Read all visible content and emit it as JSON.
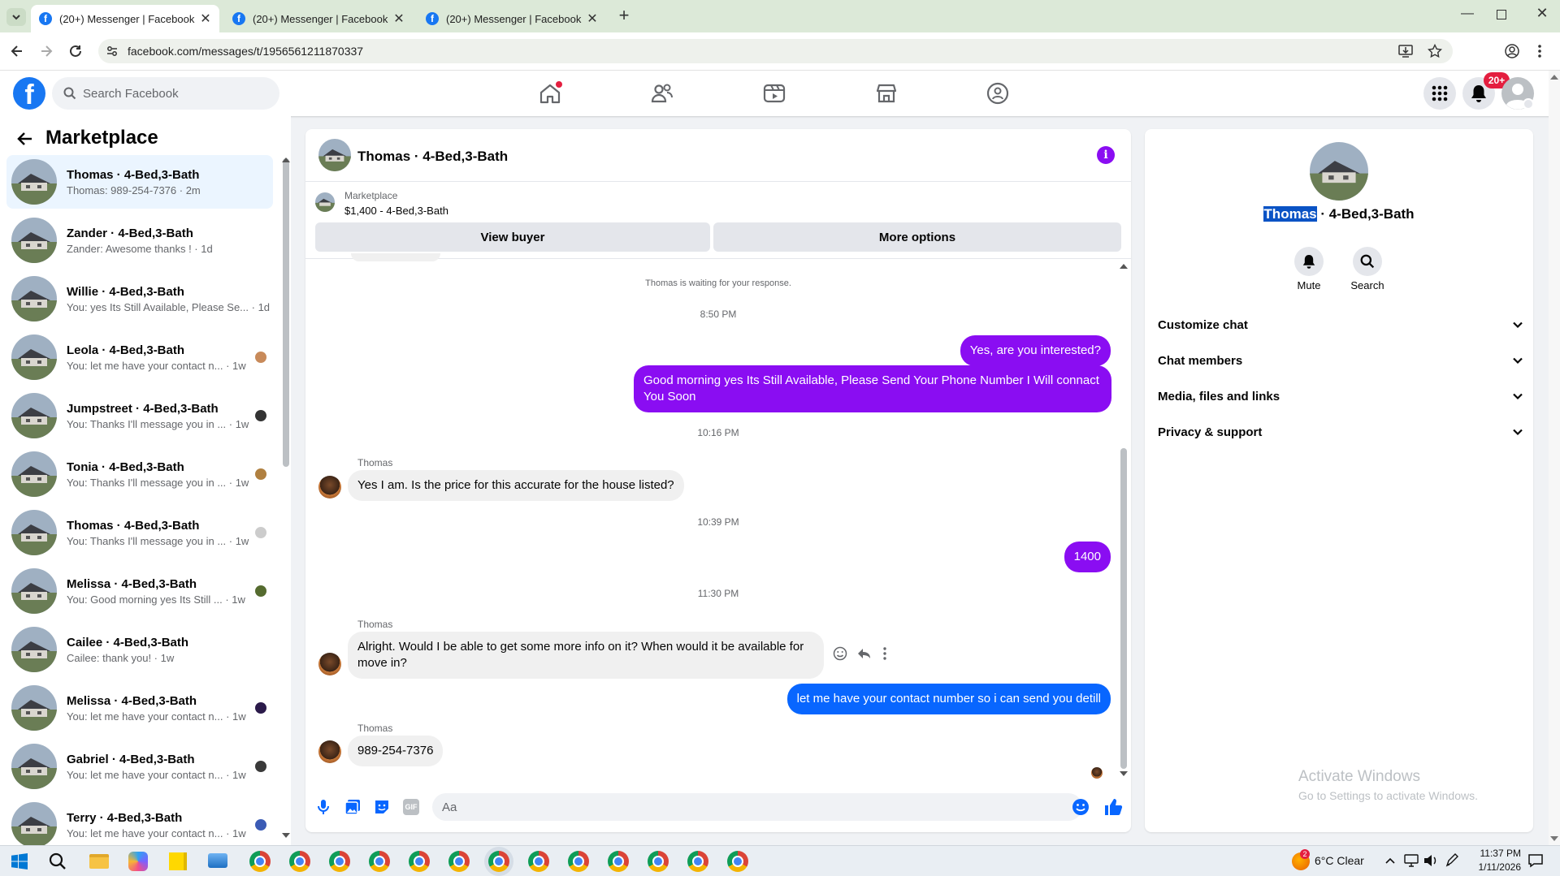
{
  "browser": {
    "tabs": [
      {
        "title": "(20+) Messenger | Facebook"
      },
      {
        "title": "(20+) Messenger | Facebook"
      },
      {
        "title": "(20+) Messenger | Facebook"
      }
    ],
    "url": "facebook.com/messages/t/1956561211870337"
  },
  "facebook": {
    "search_placeholder": "Search Facebook",
    "notification_badge": "20+"
  },
  "sidebar": {
    "title": "Marketplace",
    "conversations": [
      {
        "name": "Thomas · 4-Bed,3-Bath",
        "preview": "Thomas: 989-254-7376 · 2m",
        "selected": true
      },
      {
        "name": "Zander · 4-Bed,3-Bath",
        "preview": "Zander: Awesome thanks ! · 1d"
      },
      {
        "name": "Willie · 4-Bed,3-Bath",
        "preview": "You: yes Its Still Available, Please Se... · 1d"
      },
      {
        "name": "Leola · 4-Bed,3-Bath",
        "preview": "You: let me have your contact n... · 1w"
      },
      {
        "name": "Jumpstreet · 4-Bed,3-Bath",
        "preview": "You: Thanks I'll message you in ... · 1w"
      },
      {
        "name": "Tonia · 4-Bed,3-Bath",
        "preview": "You: Thanks I'll message you in ... · 1w"
      },
      {
        "name": "Thomas · 4-Bed,3-Bath",
        "preview": "You: Thanks I'll message you in ... · 1w"
      },
      {
        "name": "Melissa · 4-Bed,3-Bath",
        "preview": "You: Good morning yes Its Still ... · 1w"
      },
      {
        "name": "Cailee · 4-Bed,3-Bath",
        "preview": "Cailee: thank you! · 1w"
      },
      {
        "name": "Melissa · 4-Bed,3-Bath",
        "preview": "You: let me have your contact n... · 1w"
      },
      {
        "name": "Gabriel · 4-Bed,3-Bath",
        "preview": "You: let me have your contact n... · 1w"
      },
      {
        "name": "Terry · 4-Bed,3-Bath",
        "preview": "You: let me have your contact n... · 1w"
      }
    ]
  },
  "chat": {
    "header_title": "Thomas · 4-Bed,3-Bath",
    "listing_source": "Marketplace",
    "listing_price": "$1,400 - 4-Bed,3-Bath",
    "view_buyer": "View buyer",
    "more_options": "More options",
    "waiting_note": "Thomas is waiting for your response.",
    "timestamps": [
      "8:50 PM",
      "10:16 PM",
      "10:39 PM",
      "11:30 PM"
    ],
    "messages": {
      "m1": "Yes, are you interested?",
      "m2": "Good morning yes  Its Still Available, Please Send Your Phone Number I Will connact You Soon",
      "m3": "Yes I am. Is the price for this accurate for the house listed?",
      "m4": "1400",
      "m5": "Alright. Would I be able to get some more info on it? When would it be available for move in?",
      "m6": "let me have your contact number so i can send you detill",
      "m7": "989-254-7376"
    },
    "sender_name": "Thomas",
    "composer_placeholder": "Aa"
  },
  "details": {
    "name_highlight": "Thomas",
    "name_rest": " · 4-Bed,3-Bath",
    "mute": "Mute",
    "search": "Search",
    "sections": [
      "Customize chat",
      "Chat members",
      "Media, files and links",
      "Privacy & support"
    ]
  },
  "watermark": {
    "line1": "Activate Windows",
    "line2": "Go to Settings to activate Windows."
  },
  "taskbar": {
    "weather": "6°C  Clear",
    "weather_badge": "2",
    "time": "11:37 PM",
    "date": "1/11/2026"
  },
  "colors": {
    "outgoing_bubble": "#8a0df2",
    "selected_outgoing": "#0866ff",
    "facebook_blue": "#1877f2",
    "badge_red": "#e41e3f"
  }
}
